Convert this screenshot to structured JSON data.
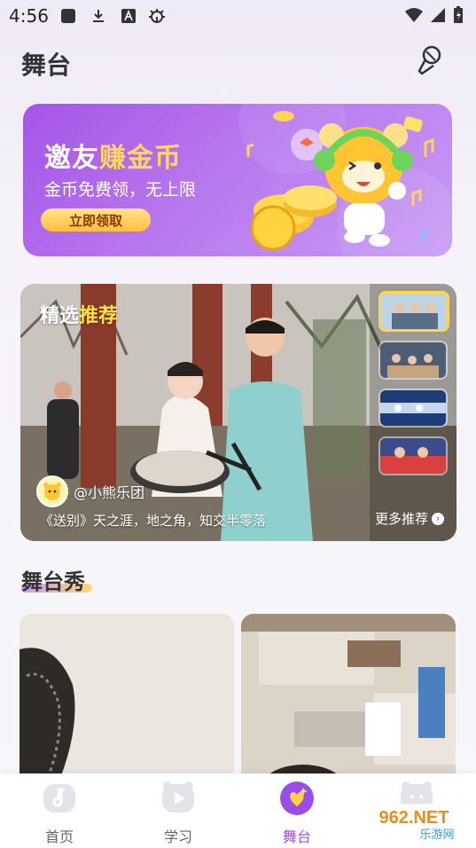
{
  "status_bar": {
    "time": "4:56",
    "left_icons": [
      "square-app-icon",
      "download-icon",
      "a-badge-icon",
      "bug-icon"
    ],
    "right_icons": [
      "wifi-icon",
      "signal-icon",
      "battery-icon"
    ]
  },
  "header": {
    "title": "舞台",
    "mic_icon": "microphone-icon"
  },
  "banner": {
    "title_part1": "邀友",
    "title_part2": "赚金币",
    "subtitle": "金币免费领，无上限",
    "button_label": "立即领取",
    "colors": {
      "bg_start": "#a455e7",
      "bg_end": "#c79cf4",
      "accent": "#ffd956"
    }
  },
  "featured": {
    "tag_part1": "精选",
    "tag_part2": "推荐",
    "username": "@小熊乐团",
    "caption": "《送别》天之涯，地之角，知交半零落",
    "more_label": "更多推荐",
    "thumbnails": 4
  },
  "section": {
    "title": "舞台秀"
  },
  "tabbar": {
    "tabs": [
      {
        "label": "首页",
        "icon": "music-note-icon",
        "active": false
      },
      {
        "label": "学习",
        "icon": "play-icon",
        "active": false
      },
      {
        "label": "舞台",
        "icon": "stage-heart-icon",
        "active": true
      },
      {
        "label": "",
        "icon": "profile-bear-icon",
        "active": false
      }
    ],
    "active_color": "#a04ee5"
  },
  "watermark": {
    "line1": "962.NET",
    "line2": "乐游网"
  }
}
